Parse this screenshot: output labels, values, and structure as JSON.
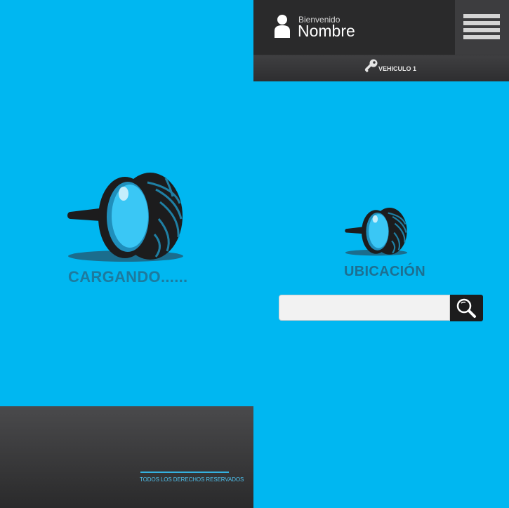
{
  "loading_screen": {
    "loading_text": "CARGANDO......",
    "footer_text": "TODOS LOS DERECHOS RESERVADOS",
    "logo_icon": "magnifier-tire-icon"
  },
  "header": {
    "welcome_label": "Bienvenido",
    "user_name": "Nombre",
    "user_icon": "user-icon",
    "menu_icon": "hamburger-menu-icon"
  },
  "vehicle_bar": {
    "icon": "key-icon",
    "label": "VEHICULO 1"
  },
  "main": {
    "logo_icon": "magnifier-tire-icon",
    "title": "UBICACIÓN",
    "search": {
      "value": "",
      "placeholder": "",
      "button_icon": "search-icon"
    }
  },
  "colors": {
    "background": "#00b7f1",
    "dark_bar": "#2a2a2b",
    "title_text": "#1d7a9e",
    "footer_accent": "#34b1e0"
  }
}
